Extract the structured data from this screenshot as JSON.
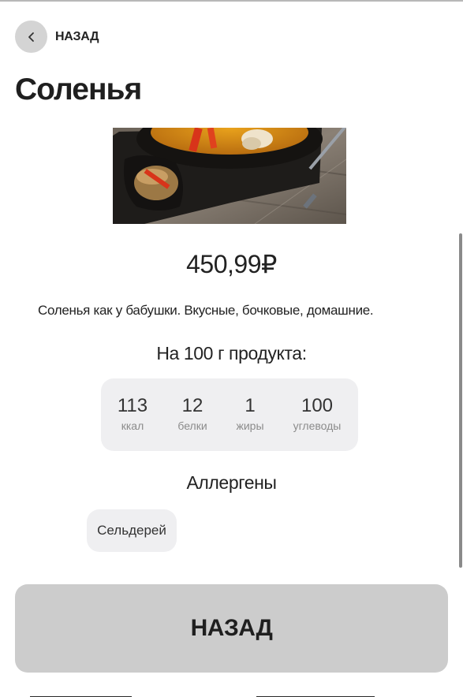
{
  "header": {
    "back_label": "НАЗАД",
    "back_icon": "chevron-left-icon"
  },
  "product": {
    "title": "Соленья",
    "image_alt": "soup-bowl-photo",
    "price": "450,99₽",
    "description": "Соленья как у бабушки. Вкусные, бочковые, домашние."
  },
  "nutrition": {
    "heading": "На 100 г продукта:",
    "items": [
      {
        "value": "113",
        "label": "ккал"
      },
      {
        "value": "12",
        "label": "белки"
      },
      {
        "value": "1",
        "label": "жиры"
      },
      {
        "value": "100",
        "label": "углеводы"
      }
    ]
  },
  "allergens": {
    "heading": "Аллергены",
    "items": [
      "Сельдерей"
    ]
  },
  "footer": {
    "back_button_label": "НАЗАД"
  },
  "colors": {
    "back_button_bg": "#cccccc",
    "chip_bg": "#efeff1",
    "text": "#1e1e1e",
    "muted_text": "#8b8b8b"
  }
}
